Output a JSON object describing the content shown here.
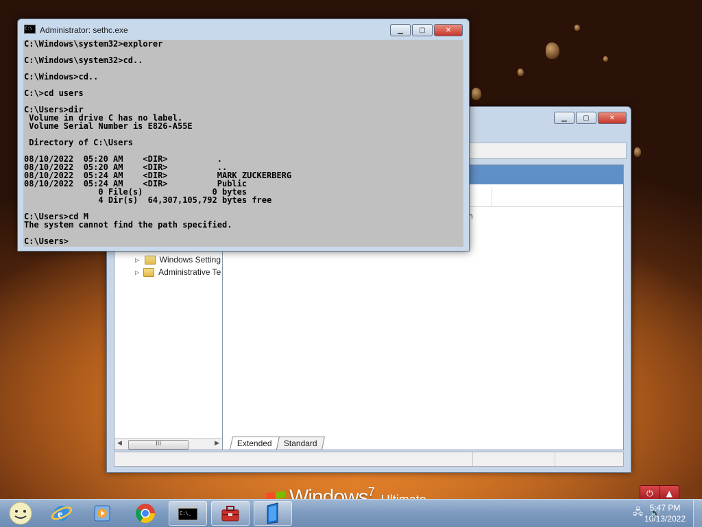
{
  "desktop": {
    "os_brand": "Windows",
    "os_version": "7",
    "os_edition": "Ultimate"
  },
  "cmd_window": {
    "title": "Administrator: sethc.exe",
    "lines": [
      "C:\\Windows\\system32>explorer",
      "",
      "C:\\Windows\\system32>cd..",
      "",
      "C:\\Windows>cd..",
      "",
      "C:\\>cd users",
      "",
      "C:\\Users>dir",
      " Volume in drive C has no label.",
      " Volume Serial Number is E826-A55E",
      "",
      " Directory of C:\\Users",
      "",
      "08/10/2022  05:20 AM    <DIR>          .",
      "08/10/2022  05:20 AM    <DIR>          ..",
      "08/10/2022  05:24 AM    <DIR>          MARK ZUCKERBERG",
      "08/10/2022  05:24 AM    <DIR>          Public",
      "               0 File(s)              0 bytes",
      "               4 Dir(s)  64,307,105,792 bytes free",
      "",
      "C:\\Users>cd M",
      "The system cannot find the path specified.",
      "",
      "C:\\Users>"
    ]
  },
  "back_window": {
    "tree_items": [
      {
        "label": "Windows Setting"
      },
      {
        "label": "Administrative Te"
      }
    ],
    "scroll_thumb": "III",
    "right_fragment": "n",
    "tabs": [
      {
        "label": "Extended"
      },
      {
        "label": "Standard"
      }
    ]
  },
  "taskbar": {
    "time": "5:47 PM",
    "date": "10/13/2022"
  },
  "colors": {
    "console_bg": "#c0c0c0",
    "taskbar": "#7e9cc0",
    "close_red": "#c6362a"
  }
}
